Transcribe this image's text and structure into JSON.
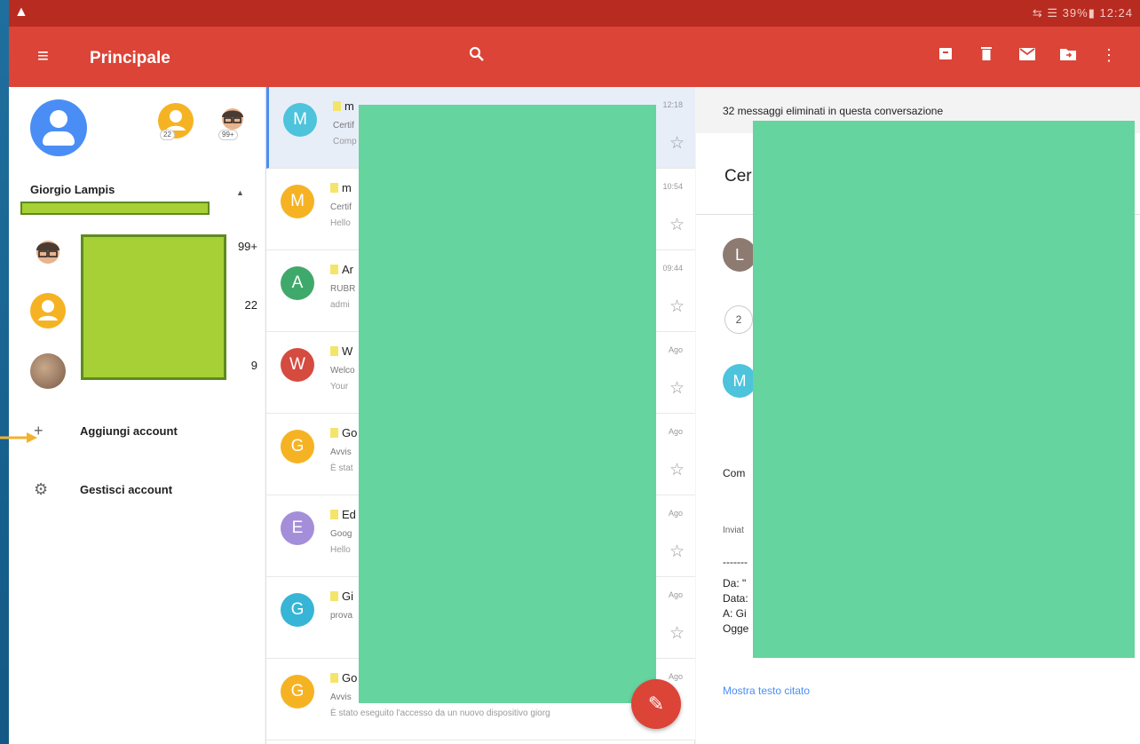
{
  "status_bar": {
    "warning_icon": "warning-icon",
    "indicators": "⇆ ☰ 39%▮ 12:24"
  },
  "app_bar": {
    "title": "Principale",
    "menu_icon": "menu-icon",
    "search_icon": "search-icon",
    "actions": [
      "archive-icon",
      "trash-icon",
      "mail-icon",
      "move-folder-icon",
      "more-vert-icon"
    ]
  },
  "drawer": {
    "account_name": "Giorgio Lampis",
    "mini_avatar_badges": [
      "22",
      "99+"
    ],
    "accounts": [
      {
        "count": "99+"
      },
      {
        "count": "22"
      },
      {
        "count": "9"
      }
    ],
    "items": [
      {
        "label": "Aggiungi account",
        "icon": "+"
      },
      {
        "label": "Gestisci account",
        "icon": "⚙"
      }
    ]
  },
  "emails": [
    {
      "letter": "M",
      "color": "#4dc3dc",
      "sender": "m",
      "line2": "Certif",
      "line3": "Comp",
      "time": "12:18",
      "selected": true
    },
    {
      "letter": "M",
      "color": "#f5b324",
      "sender": "m",
      "line2": "Certif",
      "line3": "Hello",
      "time": "10:54",
      "selected": false
    },
    {
      "letter": "A",
      "color": "#3fa96b",
      "sender": "Ar",
      "line2": "RUBR",
      "line3": "admi",
      "time": "09:44",
      "selected": false
    },
    {
      "letter": "W",
      "color": "#d64b3f",
      "sender": "W",
      "line2": "Welco",
      "line3": "Your",
      "time": "Ago",
      "selected": false
    },
    {
      "letter": "G",
      "color": "#f5b324",
      "sender": "Go",
      "line2": "Avvis",
      "line3": "È stat",
      "time": "Ago",
      "selected": false
    },
    {
      "letter": "E",
      "color": "#a48ed9",
      "sender": "Ed",
      "line2": "Goog",
      "line3": "Hello",
      "time": "Ago",
      "selected": false
    },
    {
      "letter": "G",
      "color": "#37b5d6",
      "sender": "Gi",
      "line2": "prova",
      "line3": "",
      "time": "Ago",
      "selected": false
    },
    {
      "letter": "G",
      "color": "#f5b324",
      "sender": "Go",
      "line2": "Avvis",
      "line3": "È stato eseguito l'accesso da un nuovo dispositivo giorg",
      "time": "Ago",
      "selected": false
    }
  ],
  "compose_icon": "pencil-icon",
  "detail": {
    "deleted_banner": "32 messaggi eliminati in questa conversazione",
    "subject": "Cer",
    "avatar1": "L",
    "thread_count": "2",
    "avatar2": "M",
    "body_start": "Com",
    "sent_label": "Inviat",
    "divider": "-------",
    "header_lines": [
      "Da: \"",
      "Data:",
      "A: Gi",
      "Ogge"
    ],
    "show_quoted": "Mostra testo citato"
  }
}
